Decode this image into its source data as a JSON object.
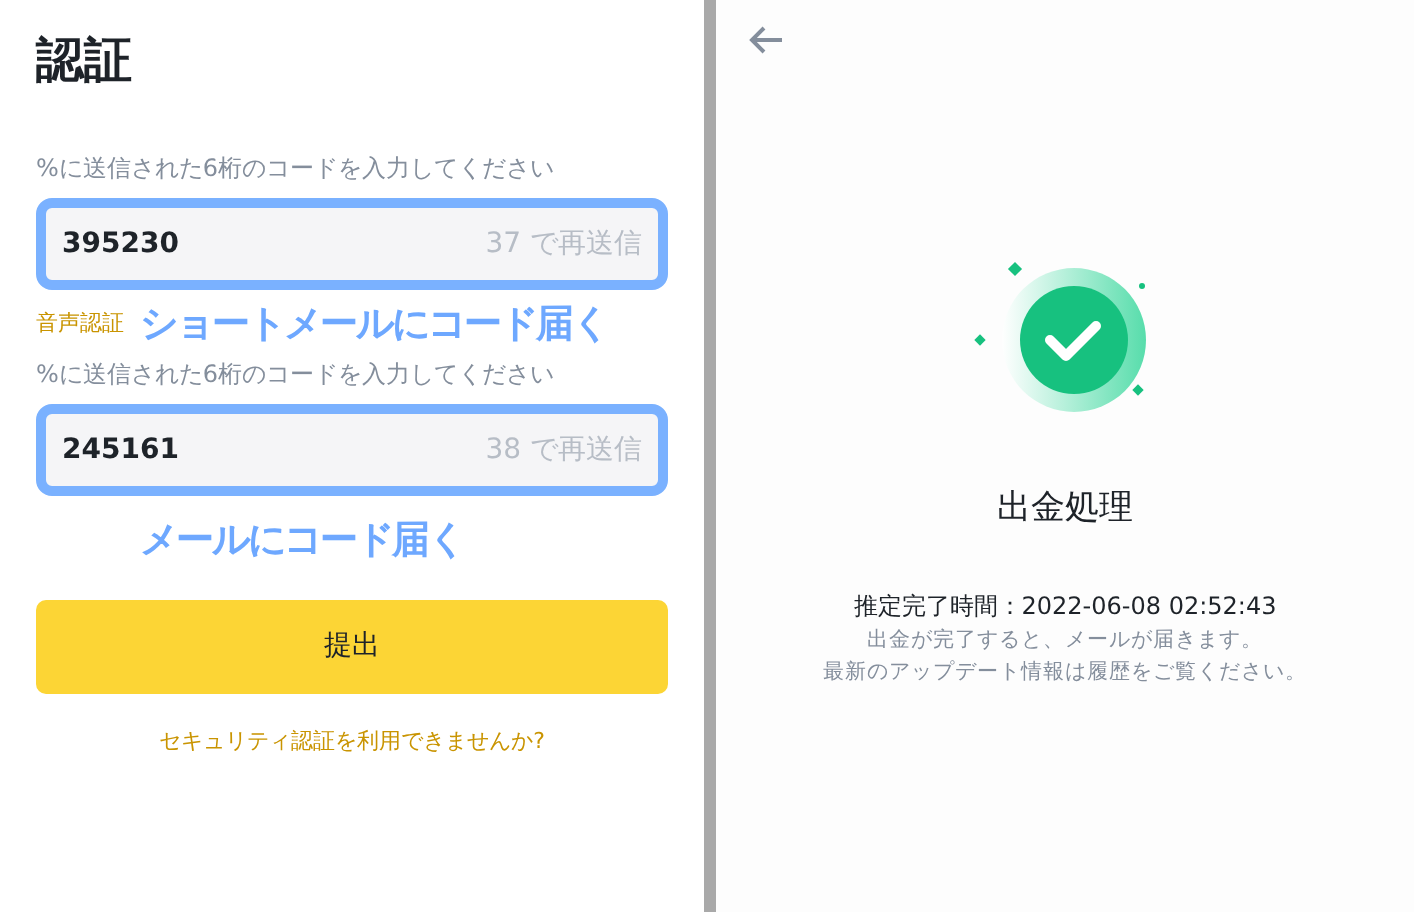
{
  "verify": {
    "title": "認証",
    "fields": [
      {
        "label": "%に送信された6桁のコードを入力してください",
        "value": "395230",
        "resend": "37 で再送信",
        "highlighted": true,
        "extra_link": "音声認証",
        "annotation": "ショートメールにコード届く"
      },
      {
        "label": "%に送信された6桁のコードを入力してください",
        "value": "245161",
        "resend": "38 で再送信",
        "highlighted": true,
        "annotation": "メールにコード届く"
      }
    ],
    "submit": "提出",
    "help_link": "セキュリティ認証を利用できませんか?"
  },
  "withdrawal": {
    "title": "出金処理",
    "estimate": "推定完了時間：2022-06-08 02:52:43",
    "notes": [
      "出金が完了すると、メールが届きます。",
      "最新のアップデート情報は履歴をご覧ください。"
    ]
  }
}
